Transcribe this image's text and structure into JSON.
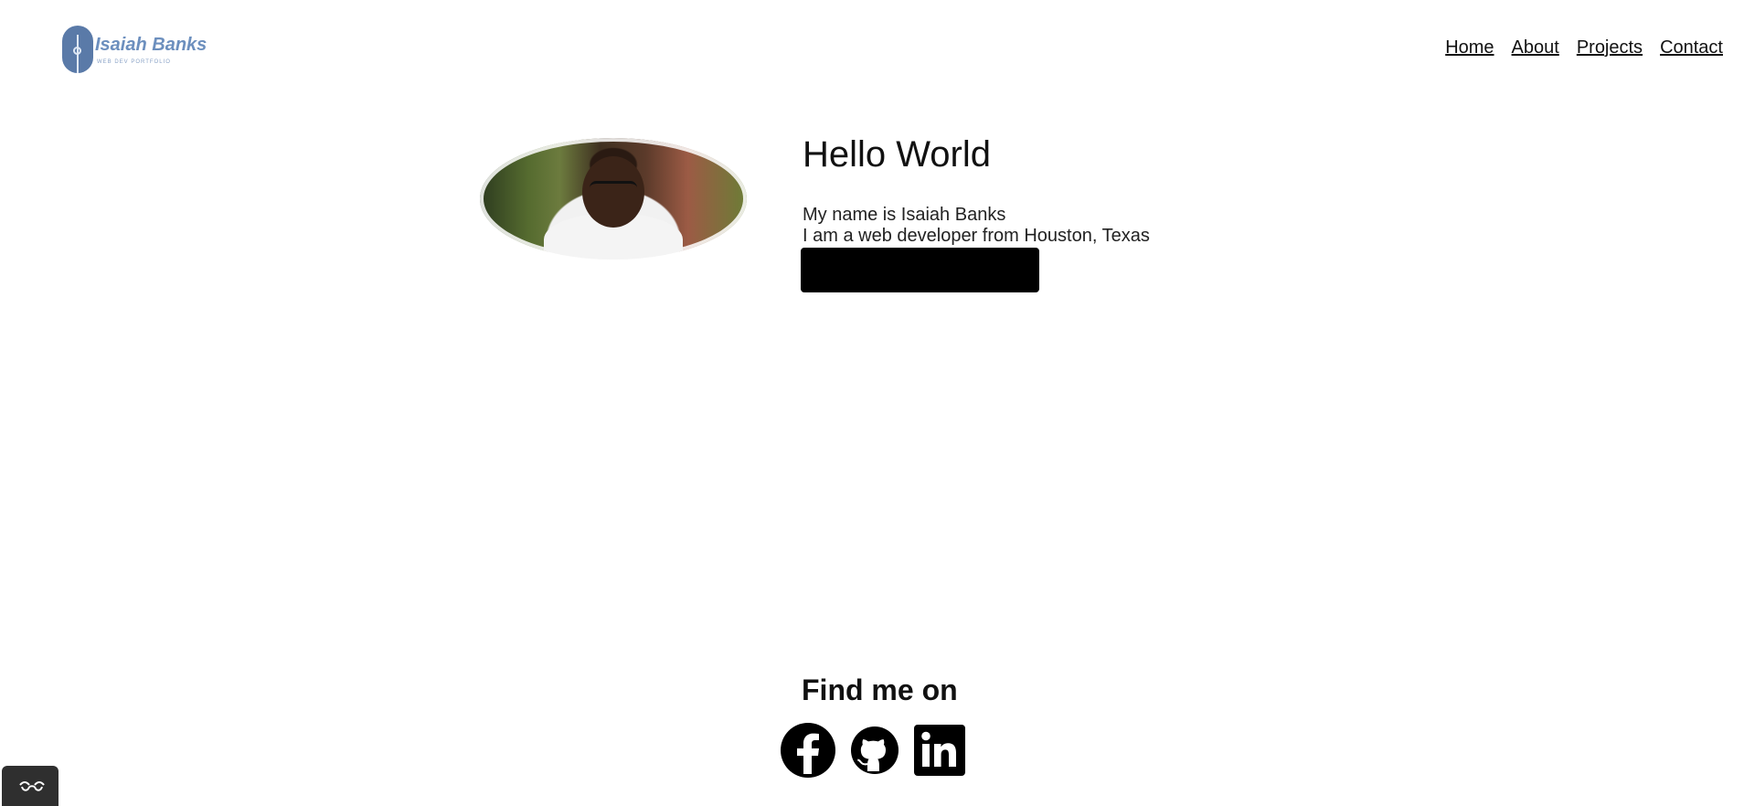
{
  "header": {
    "logo": {
      "name": "Isaiah Banks",
      "tagline": "WEB DEV PORTFOLIO",
      "icon": "portfolio-logo-icon",
      "color": "#6c8fbe"
    },
    "nav": [
      {
        "label": "Home"
      },
      {
        "label": "About"
      },
      {
        "label": "Projects"
      },
      {
        "label": "Contact"
      }
    ]
  },
  "hero": {
    "title": "Hello World",
    "line1": "My name is Isaiah Banks",
    "line2": "I am a web developer from Houston, Texas"
  },
  "social": {
    "heading": "Find me on",
    "links": [
      {
        "icon": "facebook-icon"
      },
      {
        "icon": "github-icon"
      },
      {
        "icon": "linkedin-icon"
      }
    ]
  },
  "accessibility": {
    "icon": "glasses-icon"
  }
}
